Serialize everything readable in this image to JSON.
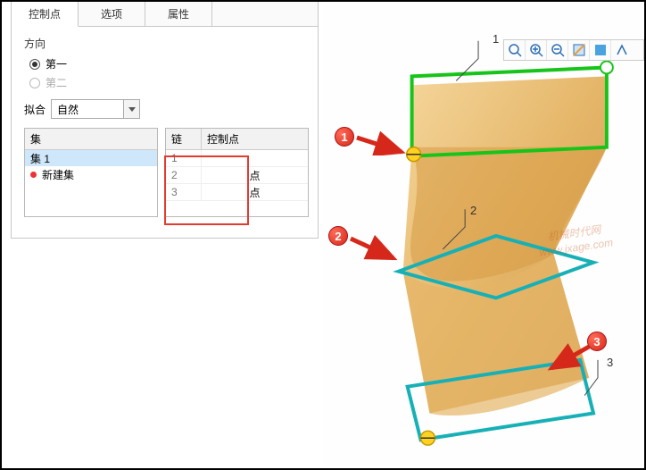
{
  "tabs": {
    "control_points": "控制点",
    "options": "选项",
    "properties": "属性"
  },
  "direction": {
    "label": "方向",
    "first": "第一",
    "second": "第二"
  },
  "fit": {
    "label": "拟合",
    "value": "自然"
  },
  "set_list": {
    "header": "集",
    "items": [
      "集 1",
      "新建集"
    ]
  },
  "cp_grid": {
    "col_chain": "链",
    "col_cp": "控制点",
    "rows": [
      {
        "n": "1",
        "v": ""
      },
      {
        "n": "2",
        "v": "点"
      },
      {
        "n": "3",
        "v": "点"
      }
    ]
  },
  "callouts": {
    "c1": "1",
    "c2": "2",
    "c3": "3"
  },
  "scene_labels": {
    "l1": "1",
    "l2": "2",
    "l3": "3"
  },
  "watermark": {
    "line1": "机械时代网",
    "line2": "www.jxage.com"
  }
}
